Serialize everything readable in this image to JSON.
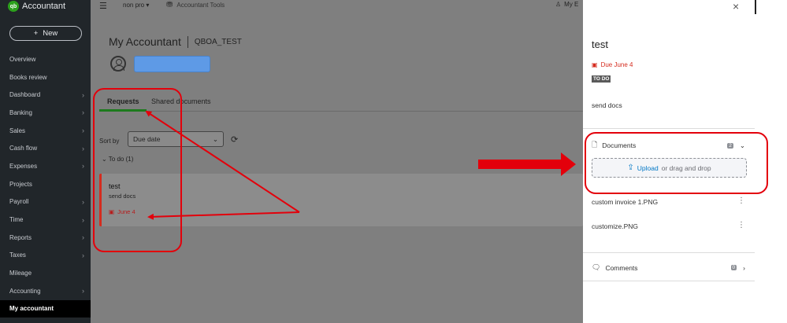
{
  "sidebar": {
    "brand_logo": "qb",
    "brand_name": "Accountant",
    "new_button": "New",
    "items": [
      {
        "label": "Overview",
        "chevron": false
      },
      {
        "label": "Books review",
        "chevron": false
      },
      {
        "label": "Dashboard",
        "chevron": true
      },
      {
        "label": "Banking",
        "chevron": true
      },
      {
        "label": "Sales",
        "chevron": true
      },
      {
        "label": "Cash flow",
        "chevron": true
      },
      {
        "label": "Expenses",
        "chevron": true
      },
      {
        "label": "Projects",
        "chevron": false
      },
      {
        "label": "Payroll",
        "chevron": true
      },
      {
        "label": "Time",
        "chevron": true
      },
      {
        "label": "Reports",
        "chevron": true
      },
      {
        "label": "Taxes",
        "chevron": true
      },
      {
        "label": "Mileage",
        "chevron": false
      },
      {
        "label": "Accounting",
        "chevron": true
      },
      {
        "label": "My accountant",
        "chevron": false,
        "active": true
      }
    ]
  },
  "topbar": {
    "company": "non pro",
    "accountant_tools": "Accountant Tools",
    "my_label": "My E"
  },
  "main": {
    "title": "My Accountant",
    "company_code": "QBOA_TEST",
    "tabs": [
      "Requests",
      "Shared documents"
    ],
    "sort_label": "Sort by",
    "sort_value": "Due date",
    "todo_label": "To do",
    "todo_count": "(1)",
    "card": {
      "title": "test",
      "subtitle": "send docs",
      "due": "June 4"
    }
  },
  "drawer": {
    "title": "test",
    "due": "Due June 4",
    "badge": "TO DO",
    "description": "send docs",
    "documents_label": "Documents",
    "documents_count": "2",
    "upload_link": "Upload",
    "upload_text": "or drag and drop",
    "files": [
      "custom invoice 1.PNG",
      "customize.PNG"
    ],
    "comments_label": "Comments",
    "comments_count": "0"
  },
  "colors": {
    "annotation_red": "#e3000b",
    "sidebar_bg": "#21262a",
    "overlay_gray": "#7f7f7f",
    "link_blue": "#0077c5",
    "active_tab_green": "#1d7a1d",
    "due_red": "#d52b1e"
  }
}
